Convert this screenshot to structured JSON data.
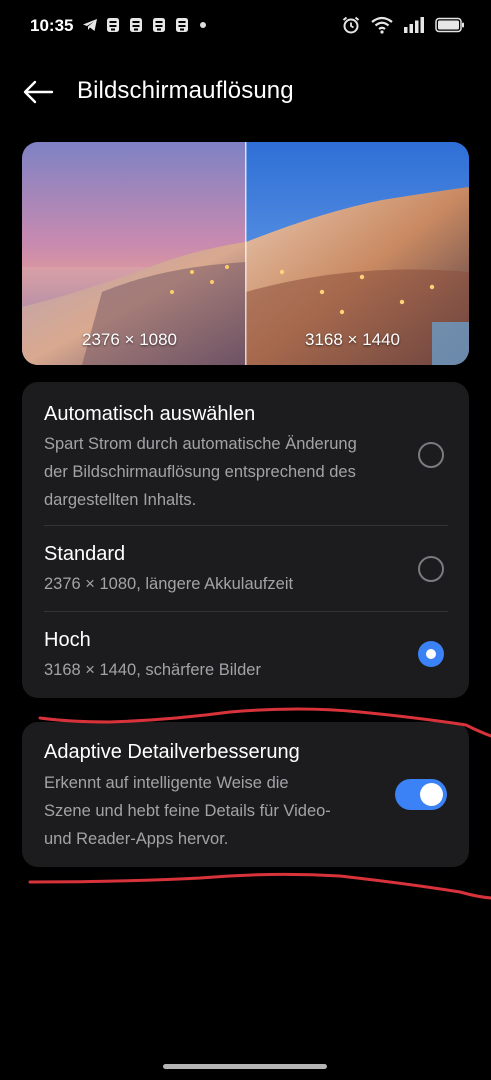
{
  "status_bar": {
    "time": "10:35",
    "notification_icons": [
      "telegram-icon",
      "app-notification-icon",
      "app-notification-icon",
      "app-notification-icon",
      "app-notification-icon"
    ],
    "system_icons": [
      "alarm-icon",
      "wifi-icon",
      "signal-icon",
      "battery-icon"
    ]
  },
  "header": {
    "title": "Bildschirmauflösung"
  },
  "preview": {
    "left_label": "2376 × 1080",
    "right_label": "3168 × 1440"
  },
  "resolution_options": [
    {
      "title": "Automatisch auswählen",
      "subtitle_lines": [
        "Spart Strom durch automatische Änderung",
        "der Bildschirmauflösung entsprechend des",
        "dargestellten Inhalts."
      ],
      "selected": false
    },
    {
      "title": "Standard",
      "subtitle_lines": [
        "2376 × 1080, längere Akkulaufzeit"
      ],
      "selected": false
    },
    {
      "title": "Hoch",
      "subtitle_lines": [
        "3168 × 1440, schärfere Bilder"
      ],
      "selected": true
    }
  ],
  "adaptive": {
    "title": "Adaptive Detailverbesserung",
    "subtitle_lines": [
      "Erkennt auf intelligente Weise die",
      "Szene und hebt feine Details für Video-",
      "und Reader-Apps hervor."
    ],
    "enabled": true
  },
  "colors": {
    "accent": "#3b82f6",
    "card": "#1c1c1e",
    "annotation": "#d8333a"
  }
}
